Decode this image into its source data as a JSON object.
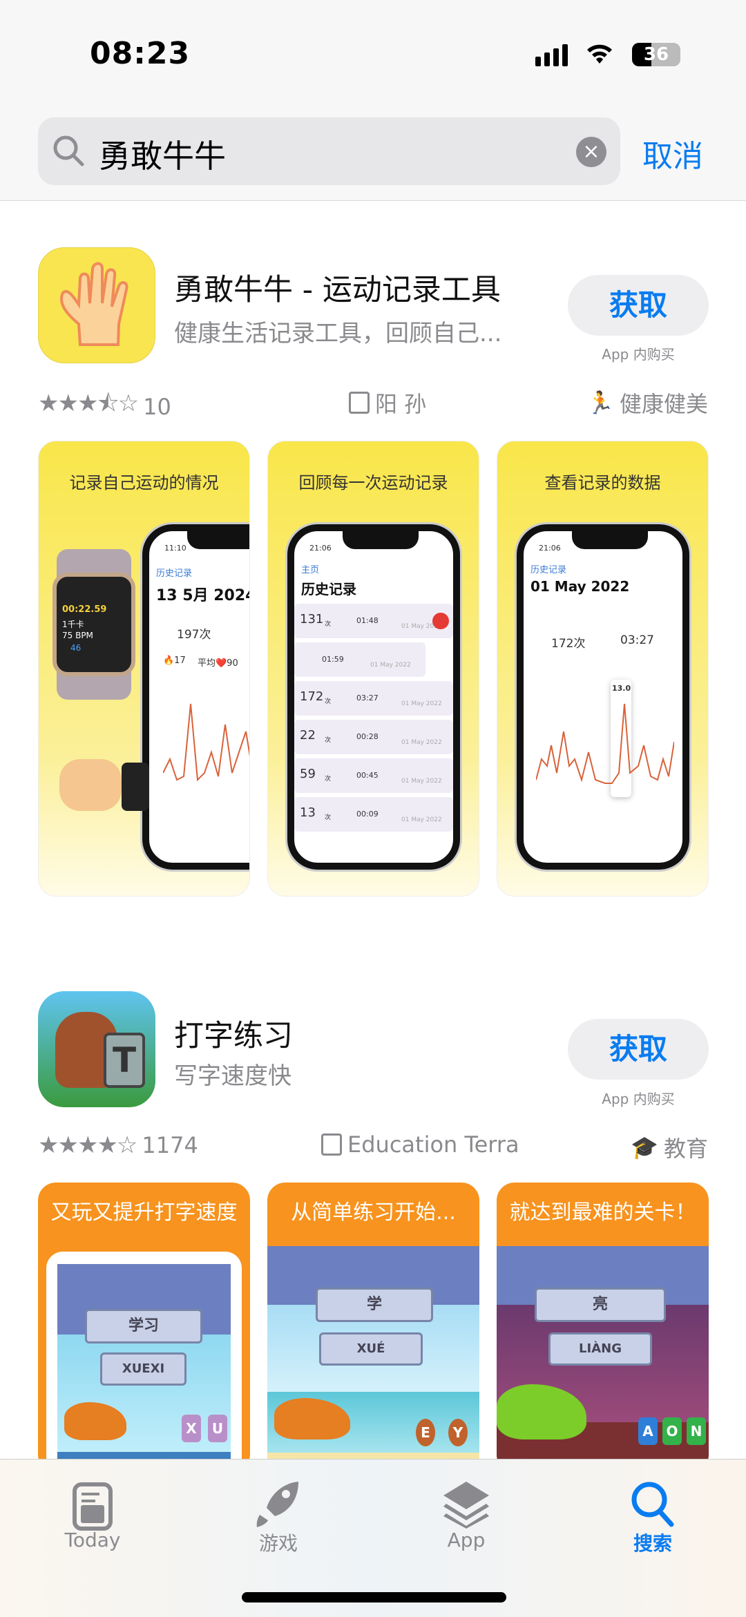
{
  "status_bar": {
    "time": "08:23",
    "battery": "36"
  },
  "search": {
    "query": "勇敢牛牛",
    "cancel_label": "取消"
  },
  "results": [
    {
      "title": "勇敢牛牛 - 运动记录工具",
      "subtitle": "健康生活记录工具，回顾自己...",
      "get_label": "获取",
      "iap_label": "App 内购买",
      "rating": 3.5,
      "rating_count": "10",
      "developer": "阳 孙",
      "category": "健康健美",
      "screenshots": [
        {
          "caption": "记录自己运动的情况",
          "time": "11:10",
          "back": "历史记录",
          "date": "13 5月 2024",
          "count": "197次",
          "stat1": "🔥17",
          "stat2": "平均❤️90",
          "watch": [
            "00:22.59",
            "1千卡",
            "75 BPM",
            "46"
          ]
        },
        {
          "caption": "回顾每一次运动记录",
          "time": "21:06",
          "back": "主页",
          "heading": "历史记录",
          "rows": [
            {
              "count": "131",
              "unit": "次",
              "dur": "01:48",
              "date": "01 May 2022"
            },
            {
              "count": "",
              "unit": "",
              "dur": "01:59",
              "date": "01 May 2022"
            },
            {
              "count": "172",
              "unit": "次",
              "dur": "03:27",
              "date": "01 May 2022"
            },
            {
              "count": "22",
              "unit": "次",
              "dur": "00:28",
              "date": "01 May 2022"
            },
            {
              "count": "59",
              "unit": "次",
              "dur": "00:45",
              "date": "01 May 2022"
            },
            {
              "count": "13",
              "unit": "次",
              "dur": "00:09",
              "date": "01 May 2022"
            }
          ]
        },
        {
          "caption": "查看记录的数据",
          "time": "21:06",
          "back": "历史记录",
          "date": "01 May 2022",
          "count": "172次",
          "duration": "03:27",
          "peak": "13.0"
        }
      ]
    },
    {
      "title": "打字练习",
      "subtitle": "写字速度快",
      "get_label": "获取",
      "iap_label": "App 内购买",
      "rating": 4,
      "rating_count": "1174",
      "developer": "Education Terra",
      "category": "教育",
      "screenshots": [
        {
          "caption": "又玩又提升打字速度",
          "word": "学习",
          "pinyin": "XUEXI",
          "tiles": [
            "X",
            "U"
          ]
        },
        {
          "caption": "从简单练习开始...",
          "word": "学",
          "pinyin": "XUÉ",
          "tiles": [
            "E",
            "Y"
          ]
        },
        {
          "caption": "就达到最难的关卡！",
          "word": "亮",
          "pinyin": "LIÀNG",
          "tiles": [
            "A",
            "O",
            "N"
          ]
        }
      ]
    }
  ],
  "tab_bar": {
    "items": [
      {
        "label": "Today",
        "icon": "today-icon"
      },
      {
        "label": "游戏",
        "icon": "rocket-icon"
      },
      {
        "label": "App",
        "icon": "layers-icon"
      },
      {
        "label": "搜索",
        "icon": "search-icon",
        "active": true
      }
    ]
  },
  "colors": {
    "accent": "#0a7cf0",
    "yellow": "#f9e64a",
    "orange": "#f7931e"
  }
}
